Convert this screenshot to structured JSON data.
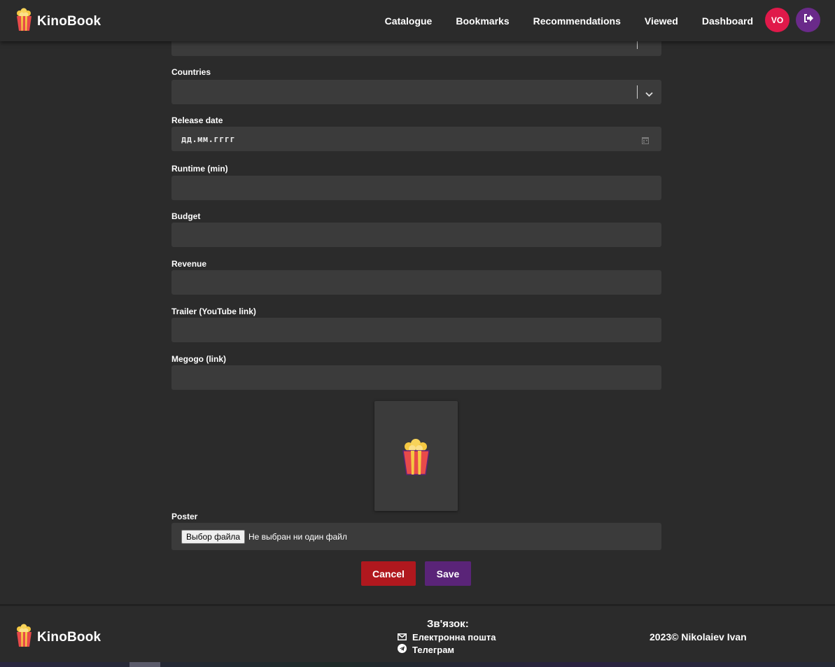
{
  "header": {
    "brand": "KinoBook",
    "nav": [
      "Catalogue",
      "Bookmarks",
      "Recommendations",
      "Viewed",
      "Dashboard"
    ],
    "avatar_initials": "VO"
  },
  "form": {
    "countries_label": "Countries",
    "release_date_label": "Release date",
    "release_date_placeholder": "дд.мм.гггг",
    "runtime_label": "Runtime (min)",
    "budget_label": "Budget",
    "revenue_label": "Revenue",
    "trailer_label": "Trailer (YouTube link)",
    "megogo_label": "Megogo (link)",
    "poster_label": "Poster",
    "file_button": "Выбор файла",
    "file_status": "Не выбран ни один файл",
    "cancel": "Cancel",
    "save": "Save"
  },
  "footer": {
    "brand": "KinoBook",
    "contact_title": "Зв'язок:",
    "email": "Електронна пошта",
    "telegram": "Телеграм",
    "copyright": "2023© Nikolaiev Ivan"
  },
  "colors": {
    "background": "#2b2b2b",
    "input": "#3b3b3b",
    "avatar": "#e0194a",
    "logout": "#6a2a8a",
    "cancel": "#b0181e",
    "save": "#5a2478"
  }
}
